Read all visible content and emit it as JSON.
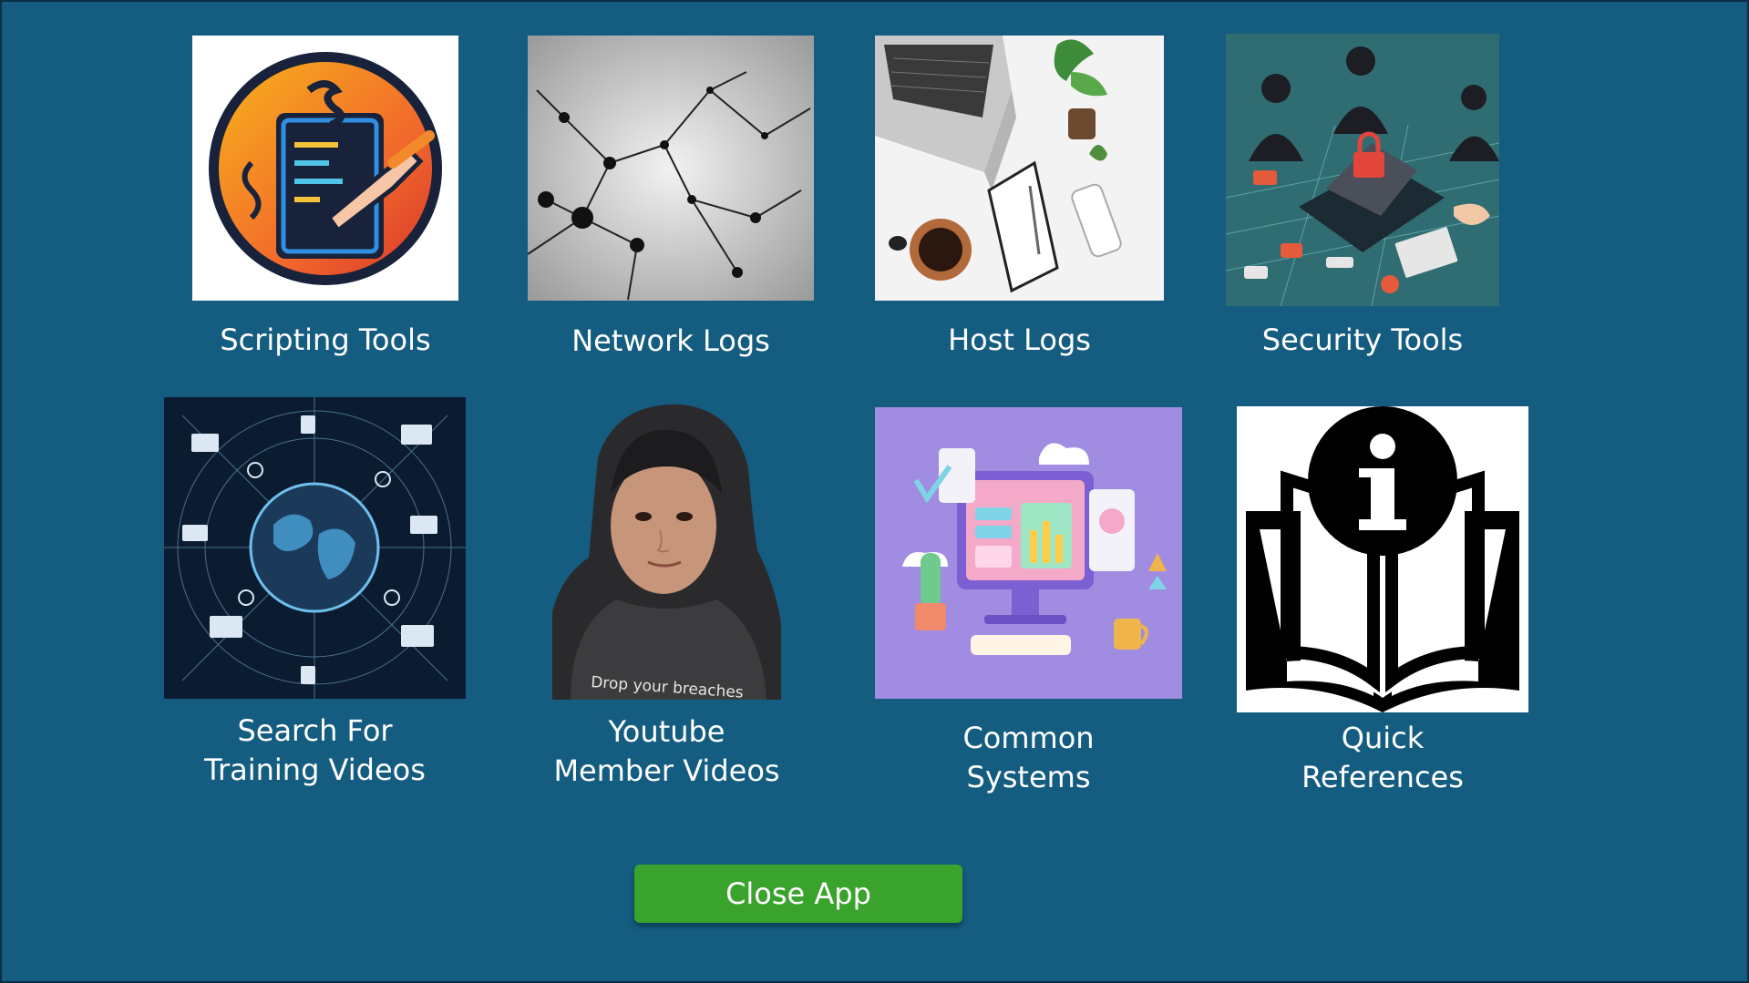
{
  "tiles": [
    {
      "label_line1": "Scripting Tools",
      "label_line2": "",
      "icon": "scripting-clipboard-icon"
    },
    {
      "label_line1": "Network Logs",
      "label_line2": "",
      "icon": "network-graph-icon"
    },
    {
      "label_line1": "Host Logs",
      "label_line2": "",
      "icon": "desk-laptop-icon"
    },
    {
      "label_line1": "Security Tools",
      "label_line2": "",
      "icon": "security-lock-icon"
    },
    {
      "label_line1": "Search For",
      "label_line2": "Training Videos",
      "icon": "globe-network-icon"
    },
    {
      "label_line1": "Youtube",
      "label_line2": "Member Videos",
      "icon": "member-portrait-icon",
      "shirt_text": "Drop your breaches"
    },
    {
      "label_line1": "Common",
      "label_line2": "Systems",
      "icon": "desktop-dashboard-icon"
    },
    {
      "label_line1": "Quick",
      "label_line2": "References",
      "icon": "info-book-icon"
    }
  ],
  "close_button": {
    "label": "Close App"
  },
  "colors": {
    "background": "#145c80",
    "button": "#3aa32c",
    "text": "#ffffff"
  }
}
